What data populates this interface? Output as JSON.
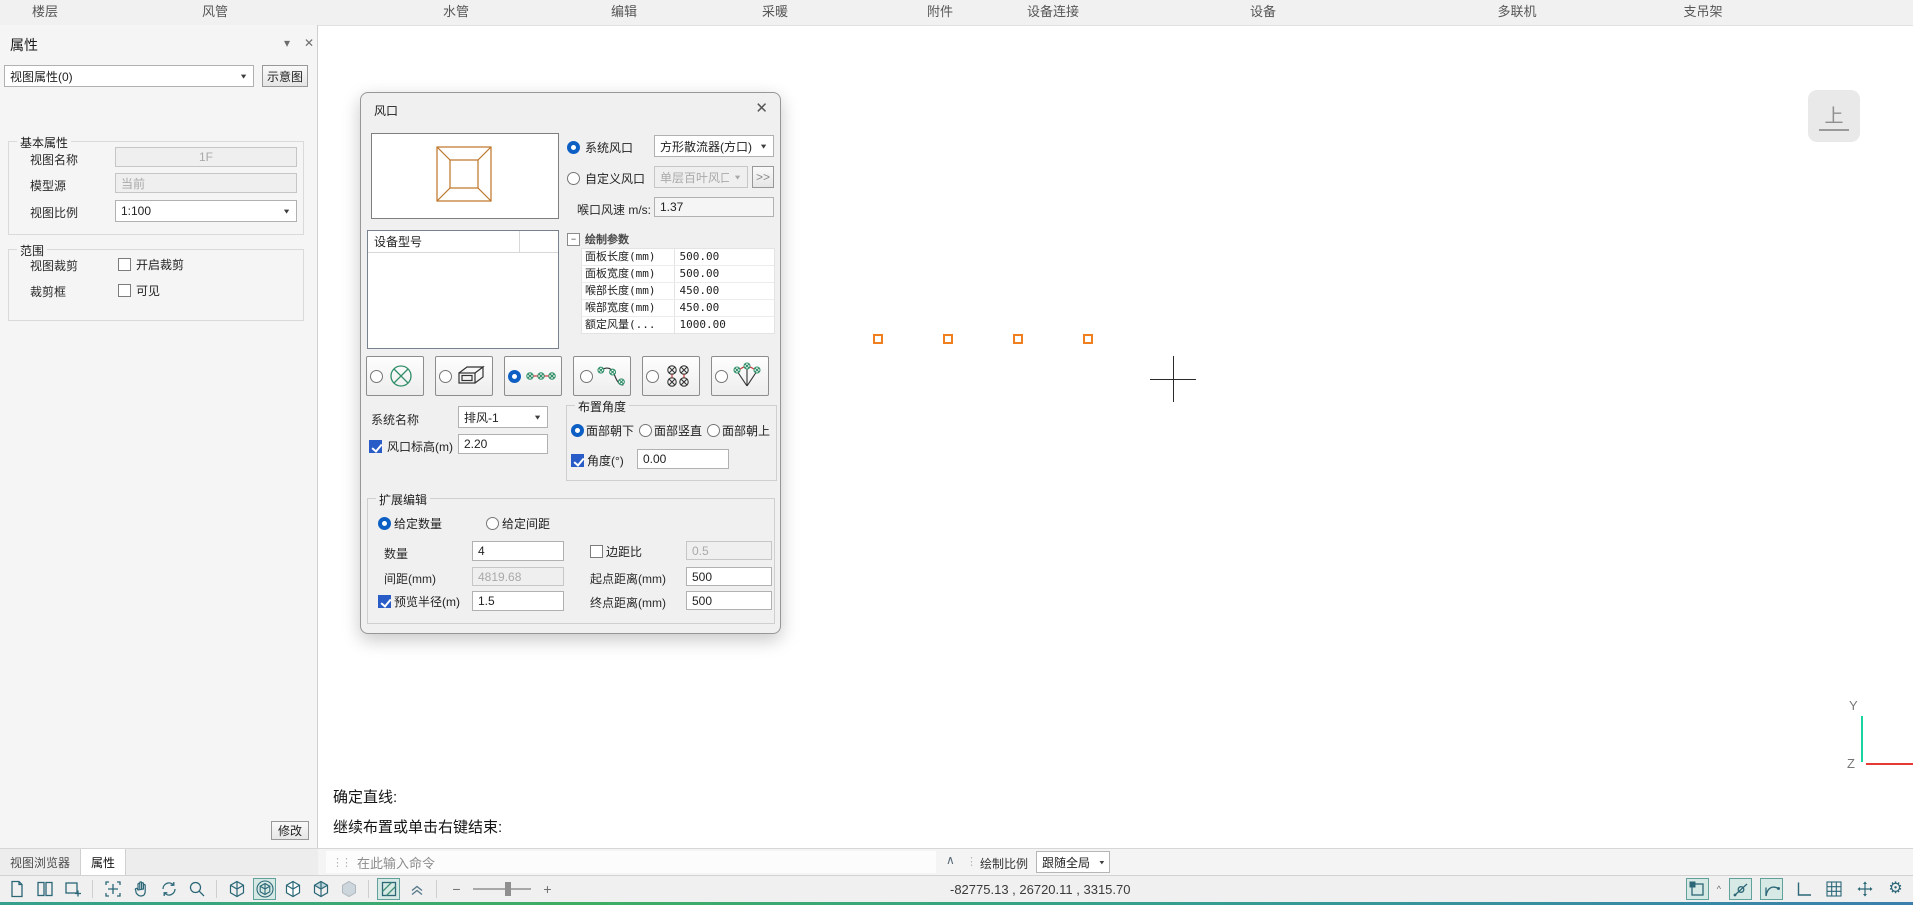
{
  "menubar": {
    "tabs": [
      {
        "label": "楼层"
      },
      {
        "label": "风管"
      },
      {
        "label": "水管"
      },
      {
        "label": "编辑"
      },
      {
        "label": "采暖"
      },
      {
        "label": "附件"
      },
      {
        "label": "设备连接"
      },
      {
        "label": "设备"
      },
      {
        "label": "多联机"
      },
      {
        "label": "支吊架"
      }
    ]
  },
  "panel": {
    "title": "属性",
    "view_selector": "视图属性(0)",
    "schematic_button": "示意图",
    "basic_group": {
      "title": "基本属性",
      "view_name_label": "视图名称",
      "view_name_value": "1F",
      "model_source_label": "模型源",
      "model_source_value": "当前",
      "view_scale_label": "视图比例",
      "view_scale_value": "1:100"
    },
    "range_group": {
      "title": "范围",
      "view_crop_label": "视图裁剪",
      "view_crop_checkbox": "开启裁剪",
      "crop_box_label": "裁剪框",
      "crop_box_checkbox": "可见"
    },
    "modify_button": "修改"
  },
  "dialog": {
    "title": "风口",
    "system_vent_label": "系统风口",
    "system_vent_value": "方形散流器(方口)",
    "custom_vent_label": "自定义风口",
    "custom_vent_value": "单层百叶风口",
    "more_button": ">>",
    "throat_speed_label": "喉口风速 m/s:",
    "throat_speed_value": "1.37",
    "device_list_header": "设备型号",
    "param_grid": {
      "title": "绘制参数",
      "rows": [
        {
          "label": "面板长度(mm)",
          "value": "500.00"
        },
        {
          "label": "面板宽度(mm)",
          "value": "500.00"
        },
        {
          "label": "喉部长度(mm)",
          "value": "450.00"
        },
        {
          "label": "喉部宽度(mm)",
          "value": "450.00"
        },
        {
          "label": "额定风量(...",
          "value": "1000.00"
        }
      ]
    },
    "layout_modes": [
      "single-vent",
      "duct-vent",
      "linear-array",
      "path-array",
      "grid-array",
      "fan-array"
    ],
    "selected_layout_mode": "linear-array",
    "system_name_label": "系统名称",
    "system_name_value": "排风-1",
    "elevation_label": "风口标高(m)",
    "elevation_value": "2.20",
    "angle_group": {
      "title": "布置角度",
      "options": [
        {
          "label": "面部朝下"
        },
        {
          "label": "面部竖直"
        },
        {
          "label": "面部朝上"
        }
      ],
      "angle_label": "角度(°)",
      "angle_value": "0.00"
    },
    "extend_group": {
      "title": "扩展编辑",
      "mode_options": [
        {
          "label": "给定数量"
        },
        {
          "label": "给定间距"
        }
      ],
      "quantity_label": "数量",
      "quantity_value": "4",
      "spacing_label": "间距(mm)",
      "spacing_value": "4819.68",
      "preview_radius_label": "预览半径(m)",
      "preview_radius_value": "1.5",
      "edge_ratio_label": "边距比",
      "edge_ratio_value": "0.5",
      "start_distance_label": "起点距离(mm)",
      "start_distance_value": "500",
      "end_distance_label": "终点距离(mm)",
      "end_distance_value": "500"
    }
  },
  "canvas": {
    "compass_label": "上",
    "axis_y_label": "Y",
    "axis_z_label": "Z",
    "history_line1": "确定直线:",
    "history_line2": "继续布置或单击右键结束:"
  },
  "bottombar": {
    "tab_view_browser": "视图浏览器",
    "tab_properties": "属性",
    "command_placeholder": "在此输入命令",
    "draw_scale_label": "绘制比例",
    "draw_scale_value": "跟随全局",
    "coordinates": "-82775.13 , 26720.11 , 3315.70"
  },
  "icons": {
    "left_toolbar": [
      "new-file",
      "window-cascade",
      "new-view",
      "zoom-extents",
      "pan",
      "orbit",
      "zoom",
      "view-wireframe",
      "view-conceptual",
      "view-hidden",
      "view-shaded",
      "view-realistic",
      "graphics-style",
      "collapse",
      "zoom-out",
      "zoom-slider",
      "zoom-in"
    ],
    "right_toolbar": [
      "object-snap",
      "polar-tracking",
      "curve-snap",
      "ortho-mode",
      "grid-display",
      "dynamic-input",
      "settings-gear"
    ]
  },
  "colors": {
    "accent_blue": "#0e5fc4",
    "vent_orange": "#f07f1f",
    "axis_y_green": "#17d4a0",
    "axis_z_red": "#e53935",
    "icon_teal": "#2b6777",
    "selection_teal_bg": "#d7e9e4"
  }
}
